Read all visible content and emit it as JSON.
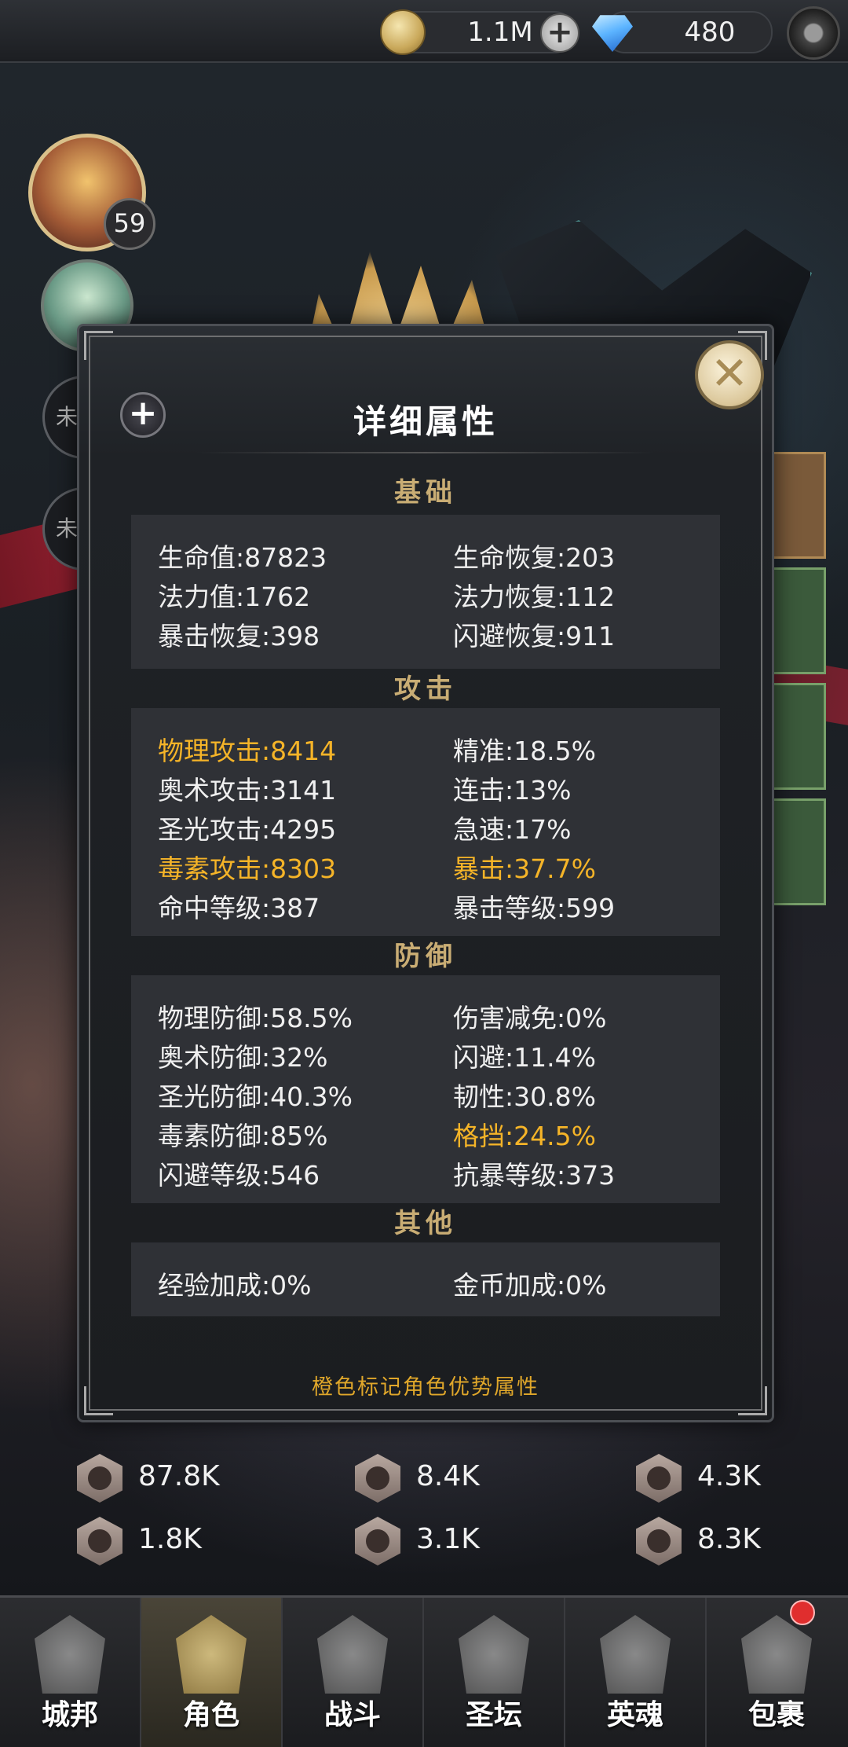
{
  "topbar": {
    "gold": "1.1M",
    "gems": "480",
    "icons": [
      "coin-icon",
      "plus-icon",
      "gem-icon",
      "settings-icon"
    ]
  },
  "roster": {
    "level": "59",
    "locked_label_1": "未",
    "locked_label_2": "未"
  },
  "dialog": {
    "title": "详细属性",
    "footer": "橙色标记角色优势属性",
    "highlight_color": "#f5b428",
    "sections": {
      "basic": {
        "title": "基础",
        "stats": [
          "生命值:87823",
          "生命恢复:203",
          "法力值:1762",
          "法力恢复:112",
          "暴击恢复:398",
          "闪避恢复:911"
        ]
      },
      "attack": {
        "title": "攻击",
        "stats": [
          "物理攻击:8414",
          "精准:18.5%",
          "奥术攻击:3141",
          "连击:13%",
          "圣光攻击:4295",
          "急速:17%",
          "毒素攻击:8303",
          "暴击:37.7%",
          "命中等级:387",
          "暴击等级:599"
        ]
      },
      "defense": {
        "title": "防御",
        "stats": [
          "物理防御:58.5%",
          "伤害减免:0%",
          "奥术防御:32%",
          "闪避:11.4%",
          "圣光防御:40.3%",
          "韧性:30.8%",
          "毒素防御:85%",
          "格挡:24.5%",
          "闪避等级:546",
          "抗暴等级:373"
        ]
      },
      "other": {
        "title": "其他",
        "stats": [
          "经验加成:0%",
          "金币加成:0%"
        ]
      }
    }
  },
  "summary": {
    "hp": "87.8K",
    "attack": "8.4K",
    "holy": "4.3K",
    "mana": "1.8K",
    "arcane": "3.1K",
    "poison": "8.3K"
  },
  "nav": [
    "城邦",
    "角色",
    "战斗",
    "圣坛",
    "英魂",
    "包裹"
  ]
}
